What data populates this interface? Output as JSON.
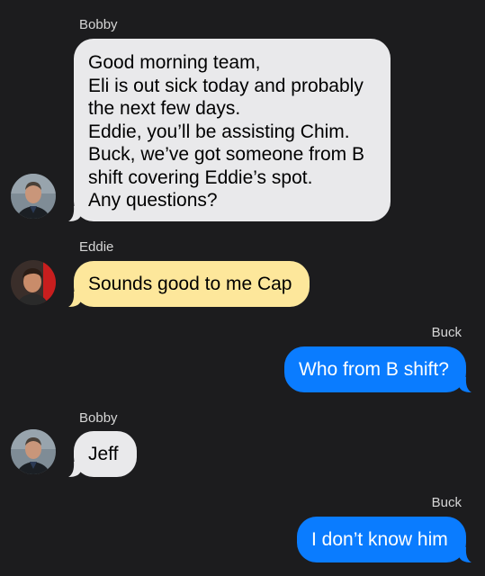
{
  "colors": {
    "background": "#1c1c1e",
    "incoming_bubble": "#e9e9eb",
    "eddie_bubble": "#fde79b",
    "outgoing_bubble": "#0a7cff"
  },
  "messages": [
    {
      "sender": "Bobby",
      "avatar": "bobby-avatar",
      "lines": [
        "Good morning team,",
        "Eli is out sick today and probably",
        "the next few days.",
        "Eddie, you’ll be assisting Chim.",
        "Buck, we’ve got someone from B",
        "shift covering Eddie’s spot.",
        "Any questions?"
      ]
    },
    {
      "sender": "Eddie",
      "avatar": "eddie-avatar",
      "lines": [
        "Sounds good to me Cap"
      ]
    },
    {
      "sender": "Buck",
      "lines": [
        "Who from B shift?"
      ]
    },
    {
      "sender": "Bobby",
      "avatar": "bobby-avatar",
      "lines": [
        "Jeff"
      ]
    },
    {
      "sender": "Buck",
      "lines": [
        "I don’t know him"
      ]
    }
  ]
}
